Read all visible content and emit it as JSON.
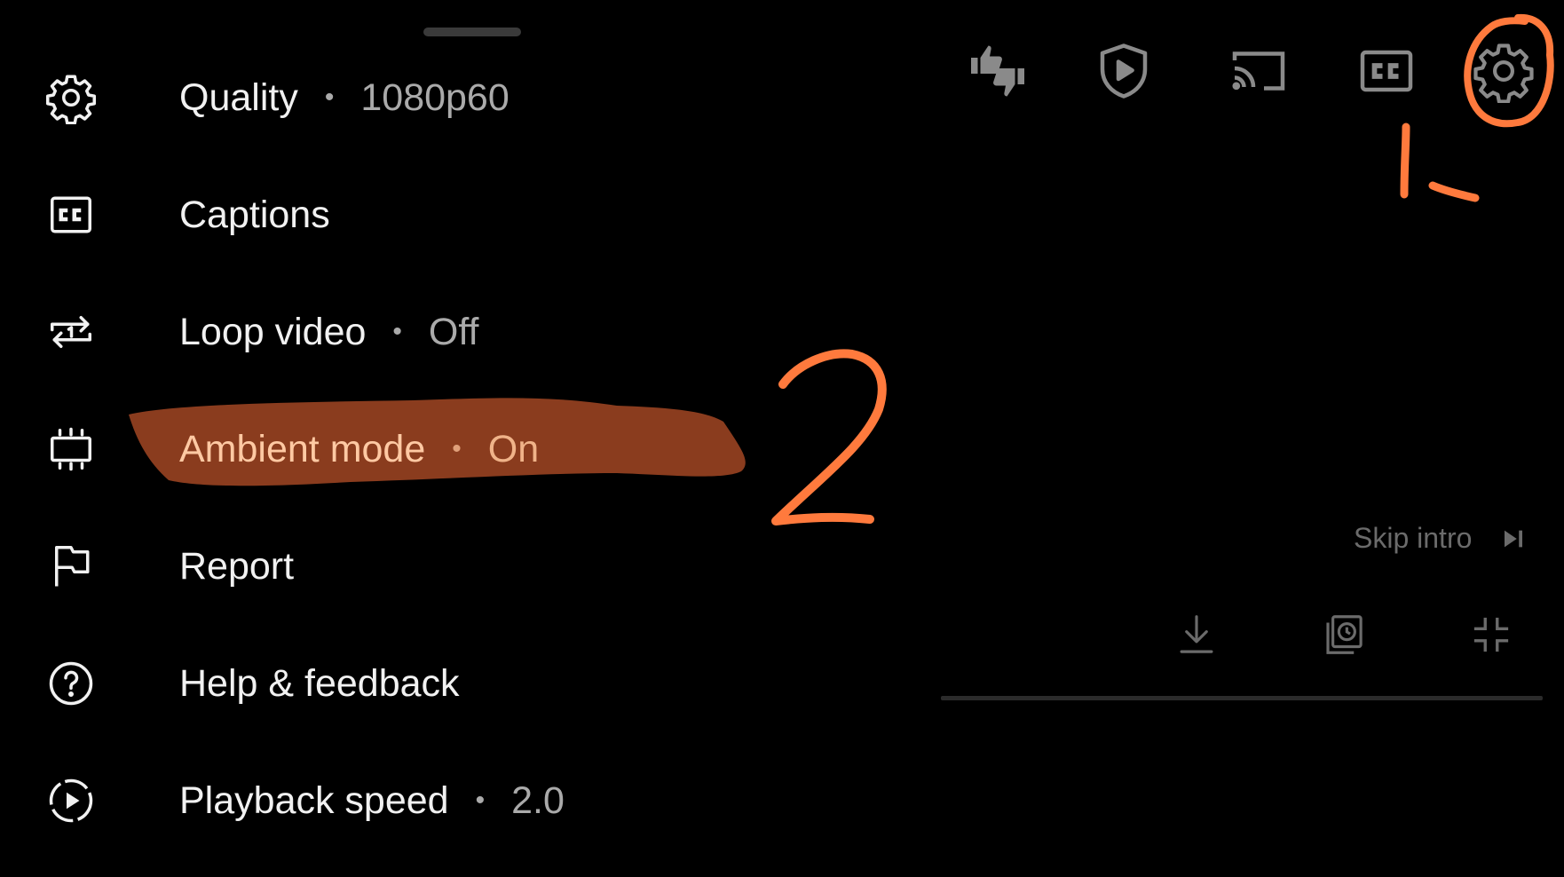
{
  "settings_menu": {
    "items": [
      {
        "label": "Quality",
        "value": "1080p60",
        "icon": "gear-icon"
      },
      {
        "label": "Captions",
        "value": "",
        "icon": "cc-icon"
      },
      {
        "label": "Loop video",
        "value": "Off",
        "icon": "loop-icon"
      },
      {
        "label": "Ambient mode",
        "value": "On",
        "icon": "ambient-mode-icon"
      },
      {
        "label": "Report",
        "value": "",
        "icon": "flag-icon"
      },
      {
        "label": "Help & feedback",
        "value": "",
        "icon": "help-icon"
      },
      {
        "label": "Playback speed",
        "value": "2.0",
        "icon": "playback-speed-icon"
      }
    ],
    "separator": "•"
  },
  "player": {
    "top_controls": [
      "like-dislike-icon",
      "shield-play-icon",
      "cast-icon",
      "captions-icon",
      "settings-gear-icon"
    ],
    "skip_intro_label": "Skip intro",
    "bottom_controls": [
      "download-icon",
      "save-to-playlist-icon",
      "exit-fullscreen-icon"
    ]
  },
  "annotations": {
    "step_one": "1.",
    "step_two": "2",
    "color": "#ff7a3d",
    "highlight_color": "#8a3c1e"
  },
  "colors": {
    "background": "#000000",
    "text_primary": "#f1f1f1",
    "text_secondary": "#aaaaaa",
    "player_icons": "#8a8a8a"
  }
}
